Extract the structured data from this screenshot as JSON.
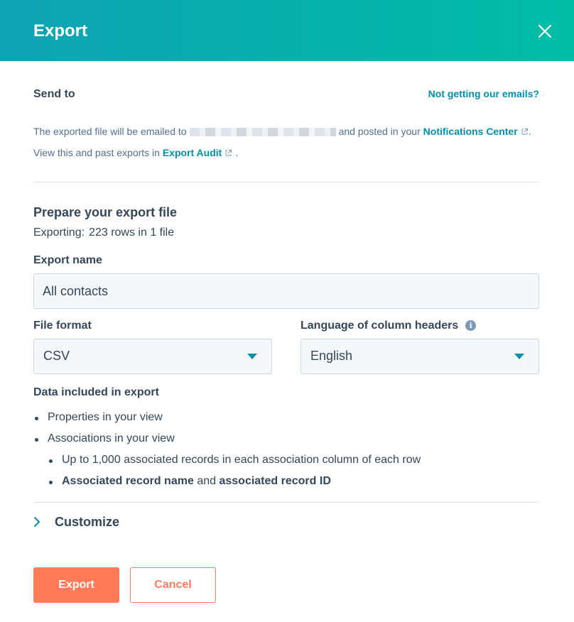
{
  "dialog": {
    "title": "Export"
  },
  "send_to": {
    "label": "Send to",
    "help_link": "Not getting our emails?",
    "text_before": "The exported file will be emailed to",
    "text_middle": "and posted in your",
    "notifications_link": "Notifications Center",
    "text_after_notifications": ". View this and past exports in",
    "audit_link": "Export Audit",
    "text_end": "."
  },
  "prepare": {
    "title": "Prepare your export file",
    "exporting_label": "Exporting:",
    "exporting_value": "223 rows in 1 file"
  },
  "export_name": {
    "label": "Export name",
    "value": "All contacts"
  },
  "file_format": {
    "label": "File format",
    "value": "CSV"
  },
  "language": {
    "label": "Language of column headers",
    "info_icon": "i",
    "value": "English"
  },
  "data_included": {
    "title": "Data included in export",
    "items": [
      "Properties in your view",
      "Associations in your view"
    ],
    "sub_items": {
      "item1": "Up to 1,000 associated records in each association column of each row",
      "item2_bold1": "Associated record name",
      "item2_and": "and",
      "item2_bold2": "associated record ID"
    }
  },
  "customize": {
    "label": "Customize"
  },
  "actions": {
    "export_label": "Export",
    "cancel_label": "Cancel"
  },
  "colors": {
    "accent": "#ff7a59",
    "link": "#0091ae",
    "header_start": "#0fa3b4",
    "header_end": "#00bda5",
    "text": "#33475b"
  },
  "icons": {
    "close": "close-icon",
    "external": "external-link-icon",
    "caret": "caret-down-icon",
    "chevron": "chevron-right-icon",
    "info": "info-icon"
  }
}
